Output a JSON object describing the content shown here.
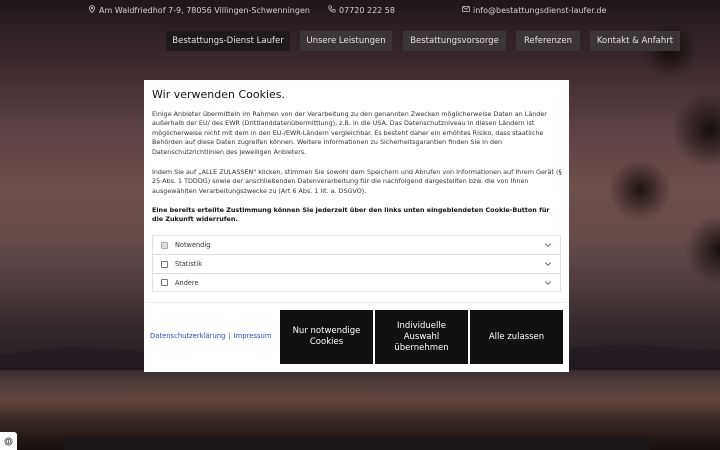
{
  "topbar": {
    "address": "Am Waldfriedhof 7-9, 78056 Villingen-Schwenningen",
    "phone": "07720 222 58",
    "email": "info@bestattungsdienst-laufer.de"
  },
  "nav": {
    "items": [
      {
        "label": "Bestattungs-Dienst Laufer"
      },
      {
        "label": "Unsere Leistungen"
      },
      {
        "label": "Bestattungsvorsorge"
      },
      {
        "label": "Referenzen"
      },
      {
        "label": "Kontakt & Anfahrt"
      }
    ]
  },
  "cookie_modal": {
    "title": "Wir verwenden Cookies.",
    "paragraph1": "Einige Anbieter übermitteln im Rahmen von der Verarbeitung zu den genannten Zwecken möglicherweise Daten an Länder außerhalb der EU/ des EWR (Drittlanddatenübermittlung), z.B. in die USA. Das Datenschutzniveau in diesen Ländern ist möglicherweise nicht mit dem in den EU-/EWR-Ländern vergleichbar. Es besteht daher ein erhöhtes Risiko, dass staatliche Behörden auf diese Daten zugreifen können. Weitere Informationen zu Sicherheitsgarantien finden Sie in den Datenschutzrichtlinien des jeweiligen Anbieters.",
    "paragraph2": "Indem Sie auf „ALLE ZULASSEN\" klicken, stimmen Sie sowohl dem Speichern und Abrufen von Informationen auf Ihrem Gerät (§ 25 Abs. 1 TDDDG) sowie der anschließenden Datenverarbeitung für die nachfolgend dargestellten bzw. die von Ihnen ausgewählten Verarbeitungszwecke zu (Art 6 Abs. 1 lit. a. DSGVO).",
    "paragraph3": "Eine bereits erteilte Zustimmung können Sie jederzeit über den links unten eingeblendeten Cookie-Button für die Zukunft widerrufen.",
    "options": [
      {
        "label": "Notwendig",
        "checked": true,
        "disabled": true
      },
      {
        "label": "Statistik",
        "checked": false,
        "disabled": false
      },
      {
        "label": "Andere",
        "checked": false,
        "disabled": false
      }
    ],
    "privacy_link": "Datenschutzerklärung",
    "separator": "|",
    "imprint_link": "Impressum",
    "btn_necessary": "Nur notwendige Cookies",
    "btn_individual": "Individuelle Auswahl übernehmen",
    "btn_all": "Alle zulassen"
  },
  "colors": {
    "nav_bg": "#3b3537",
    "nav_active_bg": "#1e1a1b",
    "button_bg": "#111111",
    "link": "#2b4bb0"
  }
}
